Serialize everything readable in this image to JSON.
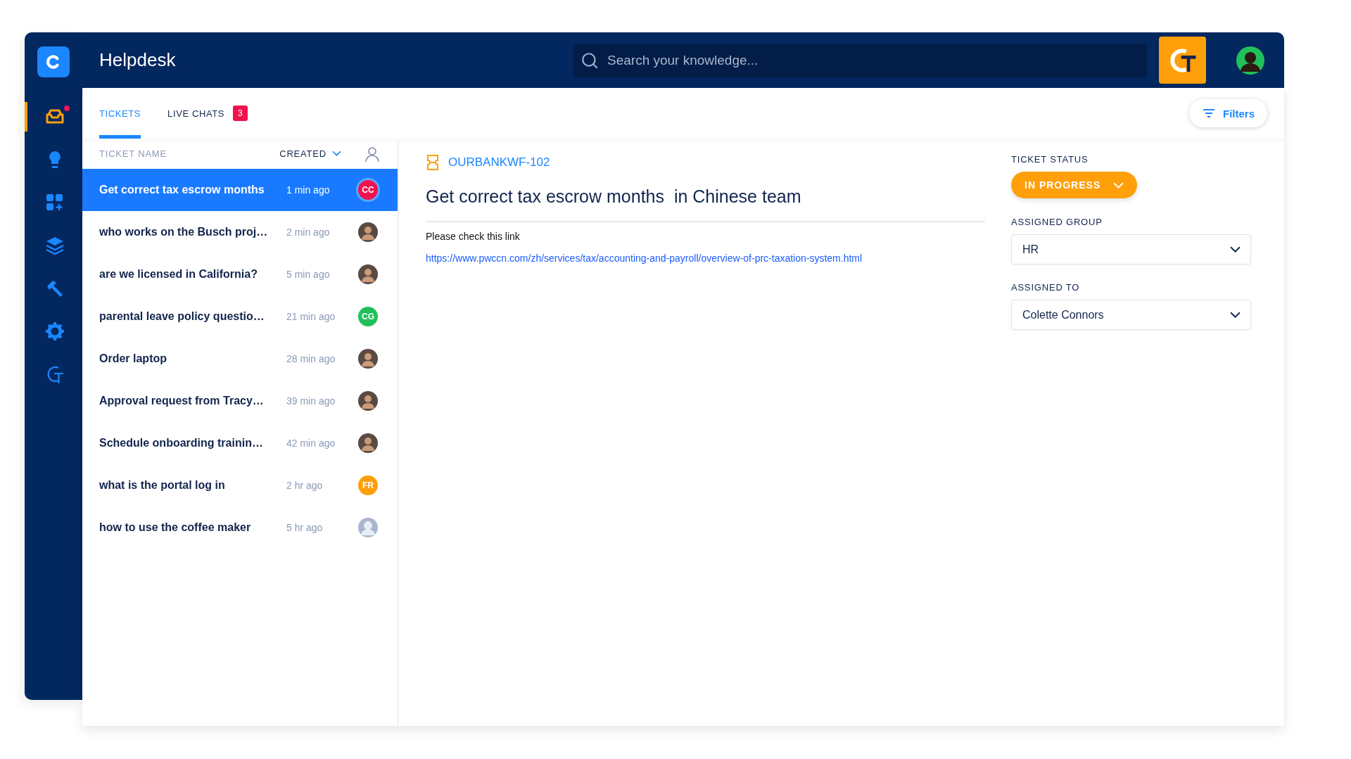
{
  "app": {
    "title": "Helpdesk"
  },
  "search": {
    "placeholder": "Search your knowledge..."
  },
  "sidebar": {
    "items": [
      {
        "selected": true,
        "notification": true
      },
      {
        "selected": false
      },
      {
        "selected": false
      },
      {
        "selected": false
      },
      {
        "selected": false
      },
      {
        "selected": false
      },
      {
        "selected": false
      }
    ]
  },
  "tabs": [
    {
      "label": "TICKETS",
      "selected": true
    },
    {
      "label": "LIVE CHATS",
      "selected": false,
      "badge": "3"
    }
  ],
  "filters_button": "Filters",
  "ticket_list": {
    "columns": [
      "TICKET NAME",
      "CREATED"
    ],
    "rows": [
      {
        "title": "Get correct tax escrow months",
        "time": "1 min ago",
        "selected": true,
        "avatar": {
          "kind": "initials",
          "initials": "CC",
          "color": "#f0134d"
        }
      },
      {
        "title": "who works on the Busch proj…",
        "time": "2 min ago",
        "selected": false,
        "avatar": {
          "kind": "photo"
        }
      },
      {
        "title": "are we licensed in California?",
        "time": "5 min ago",
        "selected": false,
        "avatar": {
          "kind": "photo"
        }
      },
      {
        "title": "parental leave policy questio…",
        "time": "21 min ago",
        "selected": false,
        "avatar": {
          "kind": "initials",
          "initials": "CG",
          "color": "#22c05a"
        }
      },
      {
        "title": "Order laptop",
        "time": "28 min ago",
        "selected": false,
        "avatar": {
          "kind": "photo"
        }
      },
      {
        "title": "Approval request from Tracy…",
        "time": "39 min ago",
        "selected": false,
        "avatar": {
          "kind": "photo"
        }
      },
      {
        "title": "Schedule onboarding trainin…",
        "time": "42 min ago",
        "selected": false,
        "avatar": {
          "kind": "photo"
        }
      },
      {
        "title": "what is the portal log in",
        "time": "2 hr ago",
        "selected": false,
        "avatar": {
          "kind": "initials",
          "initials": "FR",
          "color": "#ff9f0a"
        }
      },
      {
        "title": "how to use the coffee maker",
        "time": "5 hr ago",
        "selected": false,
        "avatar": {
          "kind": "placeholder"
        }
      }
    ]
  },
  "ticket": {
    "id": "OURBANKWF-102",
    "title": "Get correct tax escrow months  in Chinese team",
    "body": "Please check this link",
    "link": "https://www.pwccn.com/zh/services/tax/accounting-and-payroll/overview-of-prc-taxation-system.html"
  },
  "details": {
    "status_label": "TICKET STATUS",
    "status": "IN PROGRESS",
    "fields": [
      {
        "label": "ASSIGNED GROUP",
        "value": "HR"
      },
      {
        "label": "ASSIGNED TO",
        "value": "Colette Connors"
      }
    ]
  }
}
